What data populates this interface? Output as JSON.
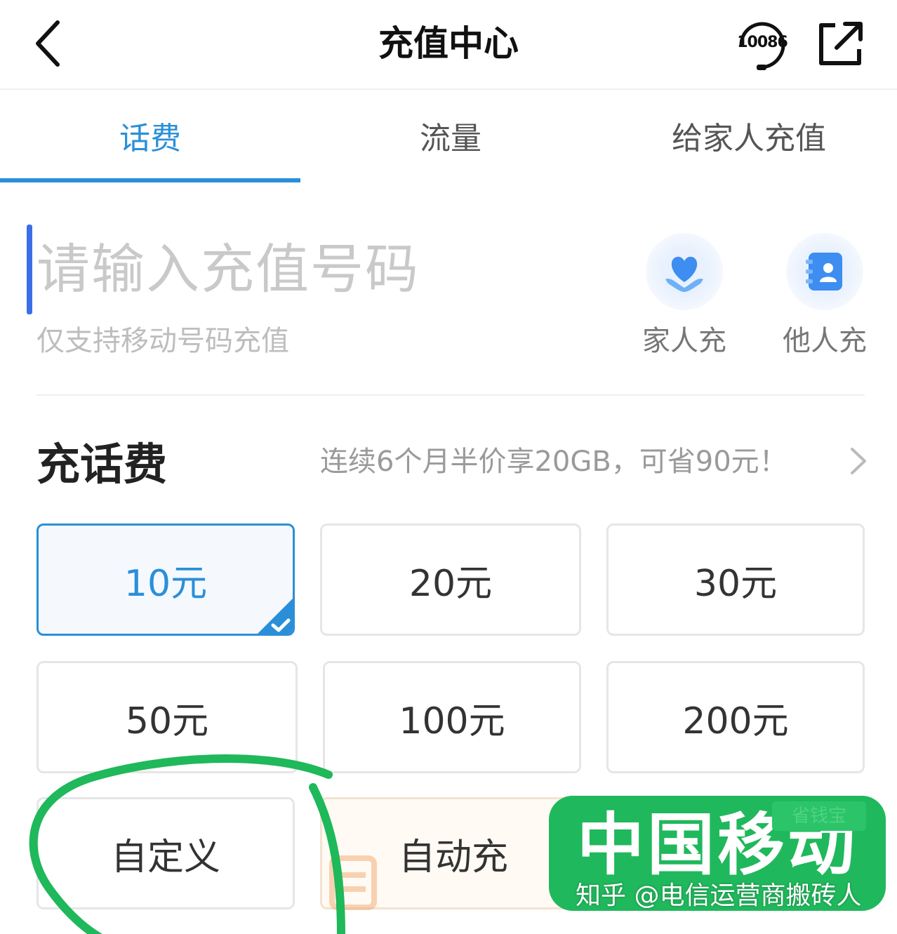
{
  "header": {
    "title": "充值中心",
    "hotline_number": "10086"
  },
  "tabs": [
    {
      "label": "话费",
      "active": true
    },
    {
      "label": "流量",
      "active": false
    },
    {
      "label": "给家人充值",
      "active": false
    }
  ],
  "phone_input": {
    "placeholder": "请输入充值号码",
    "hint": "仅支持移动号码充值"
  },
  "quick_actions": [
    {
      "label": "家人充",
      "icon": "family-heart-icon"
    },
    {
      "label": "他人充",
      "icon": "contacts-book-icon"
    }
  ],
  "recharge_section": {
    "title": "充话费",
    "promo": "连续6个月半价享20GB，可省90元！"
  },
  "amounts": [
    {
      "label": "10元",
      "selected": true
    },
    {
      "label": "20元",
      "selected": false
    },
    {
      "label": "30元",
      "selected": false
    },
    {
      "label": "50元",
      "selected": false
    },
    {
      "label": "100元",
      "selected": false
    },
    {
      "label": "200元",
      "selected": false
    },
    {
      "label": "自定义",
      "selected": false
    },
    {
      "label": "自动充",
      "selected": false
    }
  ],
  "watermark": {
    "title": "中国移动",
    "caption": "知乎 @电信运营商搬砖人",
    "tag": "省钱宝"
  },
  "colors": {
    "accent": "#2a8fd8",
    "annotation": "#1fb85a",
    "watermark_bg": "#20b85c"
  }
}
